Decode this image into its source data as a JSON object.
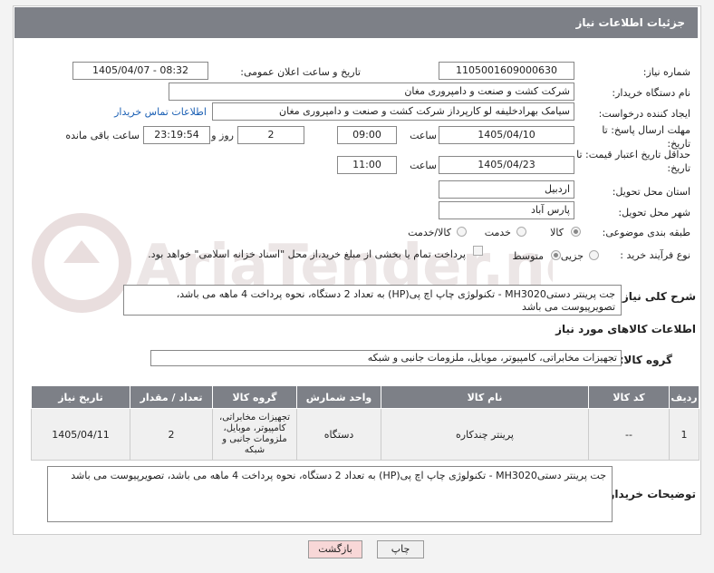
{
  "header": {
    "title": "جزئیات اطلاعات نیاز"
  },
  "fields": {
    "need_number_label": "شماره نیاز:",
    "need_number": "1105001609000630",
    "announce_label": "تاریخ و ساعت اعلان عمومی:",
    "announce_value": "1405/04/07 - 08:32",
    "buyer_label": "نام دستگاه خریدار:",
    "buyer_value": "شرکت کشت و صنعت و دامپروری مغان",
    "creator_label": "ایجاد کننده درخواست:",
    "creator_value": "سیامک بهرادخلیفه لو کارپرداز شرکت کشت و صنعت و دامپروری مغان",
    "contact_link": "اطلاعات تماس خریدار",
    "deadline_label": "مهلت ارسال پاسخ: تا تاریخ:",
    "deadline_date": "1405/04/10",
    "time_label": "ساعت",
    "deadline_time": "09:00",
    "days_value": "2",
    "days_label": "روز و",
    "remaining_time": "23:19:54",
    "remaining_label": "ساعت باقی مانده",
    "validity_label": "حداقل تاریخ اعتبار قیمت: تا تاریخ:",
    "validity_date": "1405/04/23",
    "validity_time": "11:00",
    "province_label": "استان محل تحویل:",
    "province_value": "اردبیل",
    "city_label": "شهر محل تحویل:",
    "city_value": "پارس آباد",
    "category_label": "طبقه بندی موضوعی:",
    "category_options": [
      "کالا",
      "خدمت",
      "کالا/خدمت"
    ],
    "purchase_label": "نوع فرآیند خرید :",
    "purchase_options": [
      "جزیی",
      "متوسط"
    ],
    "payment_note": "پرداخت تمام یا بخشی از مبلغ خرید،از محل \"اسناد خزانه اسلامی\" خواهد بود."
  },
  "description": {
    "label": "شرح کلی نیاز:",
    "text": "جت پرینتر دستیMH3020 -  تکنولوژی چاپ اچ پی(HP) به تعداد 2 دستگاه، نحوه پرداخت 4 ماهه می باشد، تصویرپیوست  می باشد"
  },
  "goods": {
    "section_title": "اطلاعات کالاهای مورد نیاز",
    "group_label": "گروه کالا:",
    "group_value": "تجهیزات مخابراتی، کامپیوتر، موبایل، ملزومات جانبی و شبکه",
    "columns": [
      "ردیف",
      "کد کالا",
      "نام کالا",
      "واحد شمارش",
      "گروه کالا",
      "تعداد / مقدار",
      "تاریخ نیاز"
    ],
    "rows": [
      [
        "1",
        "--",
        "پرینتر چندکاره",
        "دستگاه",
        "تجهیزات مخابراتی، کامپیوتر، موبایل، ملزومات جانبی و شبکه",
        "2",
        "1405/04/11"
      ]
    ]
  },
  "buyer_notes": {
    "label": "توضیحات خریدار:",
    "text": "جت پرینتر دستیMH3020 -  تکنولوژی چاپ اچ پی(HP) به تعداد 2 دستگاه، نحوه پرداخت 4 ماهه می باشد، تصویرپیوست می باشد"
  },
  "buttons": {
    "print": "چاپ",
    "back": "بازگشت"
  },
  "colors": {
    "header": "#7d8087",
    "link": "#1a5fb4",
    "back_button": "#f8d7d7"
  }
}
